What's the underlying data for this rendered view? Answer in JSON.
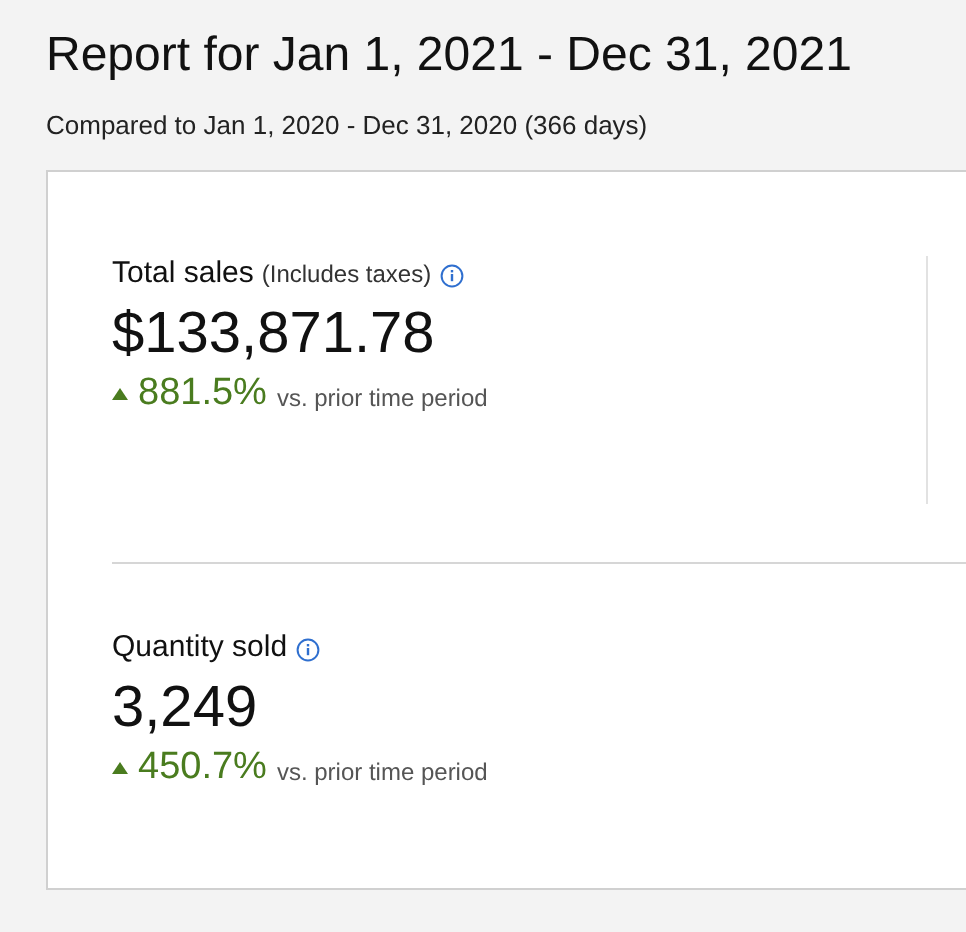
{
  "title": "Report for Jan 1, 2021 - Dec 31, 2021",
  "subtitle": "Compared to Jan 1, 2020 - Dec 31, 2020 (366 days)",
  "metrics": [
    {
      "label": "Total sales",
      "note": "(Includes taxes)",
      "value": "$133,871.78",
      "increase": true,
      "change": "881.5%",
      "comparison": "vs. prior time period"
    },
    {
      "label": "Quantity sold",
      "value": "3,249",
      "increase": true,
      "change": "450.7%",
      "comparison": "vs. prior time period"
    }
  ]
}
